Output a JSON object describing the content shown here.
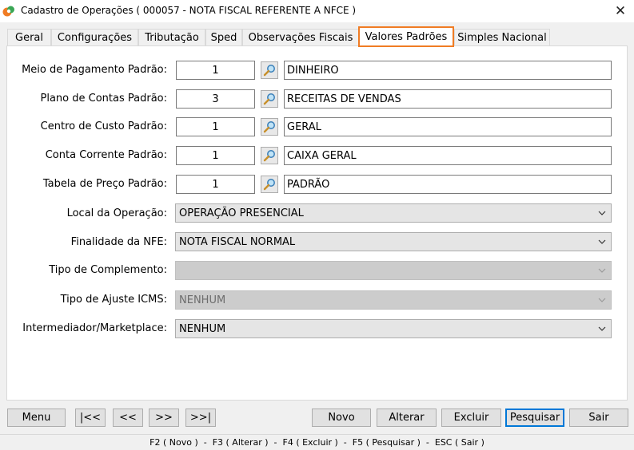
{
  "window": {
    "title": "Cadastro de Operações ( 000057 - NOTA FISCAL REFERENTE A NFCE )"
  },
  "tabs": [
    {
      "label": "Geral"
    },
    {
      "label": "Configurações"
    },
    {
      "label": "Tributação"
    },
    {
      "label": "Sped"
    },
    {
      "label": "Observações Fiscais"
    },
    {
      "label": "Valores Padrões",
      "active": true
    },
    {
      "label": "Simples Nacional"
    }
  ],
  "fields": {
    "meio_pagamento": {
      "label": "Meio de Pagamento Padrão:",
      "code": "1",
      "description": "DINHEIRO"
    },
    "plano_contas": {
      "label": "Plano de Contas Padrão:",
      "code": "3",
      "description": "RECEITAS DE VENDAS"
    },
    "centro_custo": {
      "label": "Centro de Custo Padrão:",
      "code": "1",
      "description": "GERAL"
    },
    "conta_corrente": {
      "label": "Conta Corrente Padrão:",
      "code": "1",
      "description": "CAIXA GERAL"
    },
    "tabela_preco": {
      "label": "Tabela de Preço Padrão:",
      "code": "1",
      "description": "PADRÃO"
    }
  },
  "selects": {
    "local_operacao": {
      "label": "Local da Operação:",
      "value": "OPERAÇÃO PRESENCIAL"
    },
    "finalidade_nfe": {
      "label": "Finalidade da NFE:",
      "value": "NOTA FISCAL NORMAL"
    },
    "tipo_complemento": {
      "label": "Tipo de Complemento:",
      "value": ""
    },
    "tipo_ajuste_icms": {
      "label": "Tipo de Ajuste ICMS:",
      "value": "NENHUM"
    },
    "intermediador": {
      "label": "Intermediador/Marketplace:",
      "value": "NENHUM"
    }
  },
  "buttons": {
    "menu": "Menu",
    "first": "|<<",
    "prev": "<<",
    "next": ">>",
    "last": ">>|",
    "novo": "Novo",
    "alterar": "Alterar",
    "excluir": "Excluir",
    "pesquisar": "Pesquisar",
    "sair": "Sair"
  },
  "status": {
    "shortcuts": "F2 ( Novo )  -  F3 ( Alterar )  -  F4 ( Excluir )  -  F5 ( Pesquisar )  -  ESC ( Sair )"
  },
  "icons": {
    "app": "app-logo-icon",
    "close": "close-icon",
    "lookup": "magnifier-icon",
    "dropdown": "chevron-down-icon"
  },
  "colors": {
    "active_tab_border": "#f07c24",
    "focused_button_border": "#0078d7",
    "app_icon_orange": "#f07c24",
    "app_icon_green": "#3aa655"
  }
}
